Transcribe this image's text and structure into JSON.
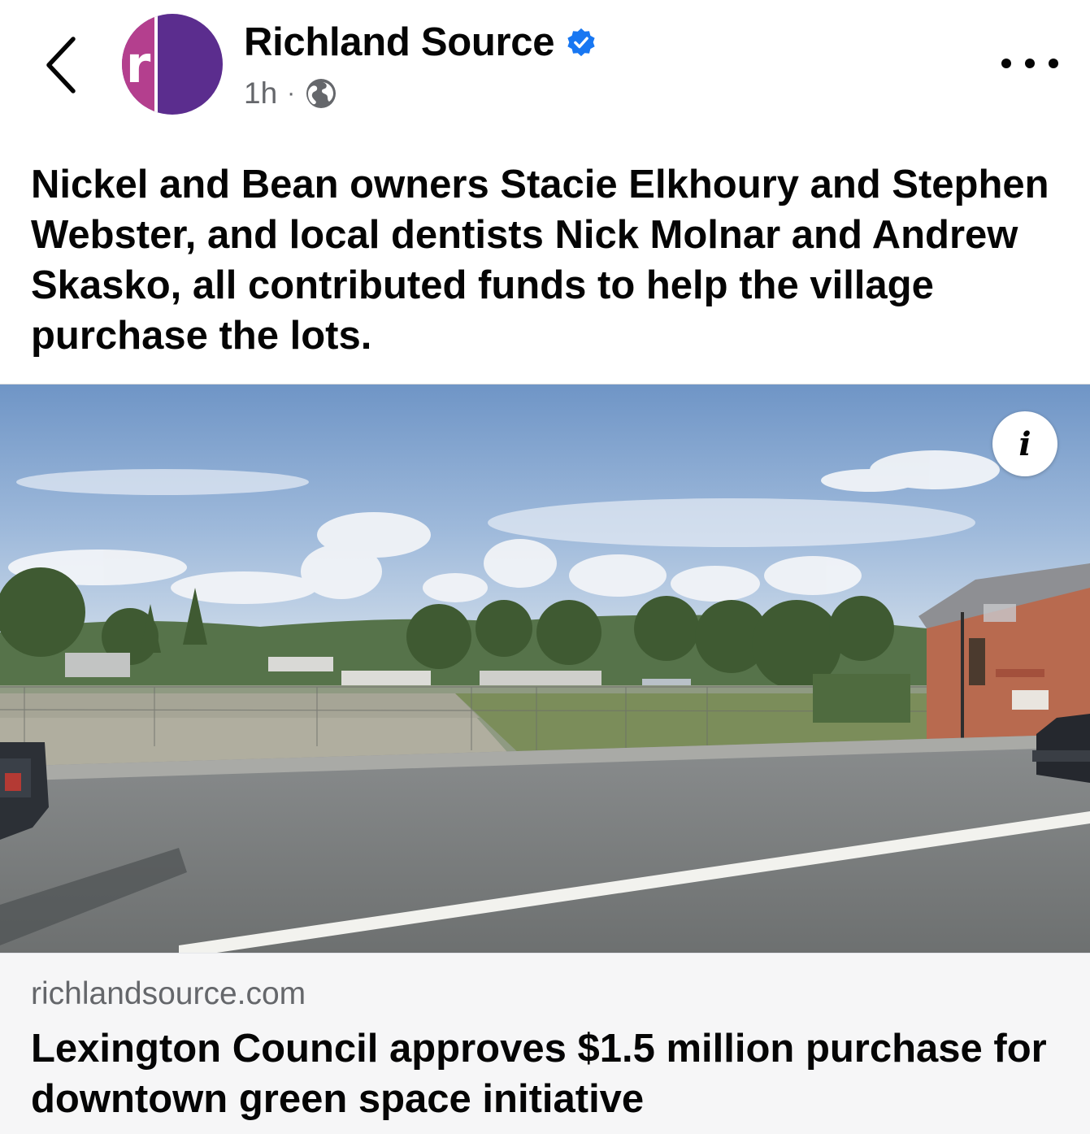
{
  "header": {
    "page_name": "Richland Source",
    "time_ago": "1h",
    "separator": "·",
    "avatar_letter": "r",
    "icons": {
      "back": "chevron-left-icon",
      "verified": "verified-badge-icon",
      "audience": "globe-icon",
      "more": "more-horizontal-icon"
    }
  },
  "post": {
    "caption": "Nickel and Bean owners Stacie Elkhoury and Stephen Webster, and local dentists Nick Molnar and Andrew Skasko, all contributed funds to help the village purchase the lots.",
    "image_description": "Street-level view of a vacant fenced lot beside a road under a cloudy blue sky",
    "info_button_glyph": "i"
  },
  "link_preview": {
    "domain": "richlandsource.com",
    "title": "Lexington Council approves $1.5 million purchase for downtown green space initiative"
  },
  "colors": {
    "brand_purple": "#5b2d8e",
    "brand_magenta": "#b43f8e",
    "verified_blue": "#1877f2",
    "secondary_text": "#65676b",
    "link_card_bg": "#f6f6f7"
  }
}
